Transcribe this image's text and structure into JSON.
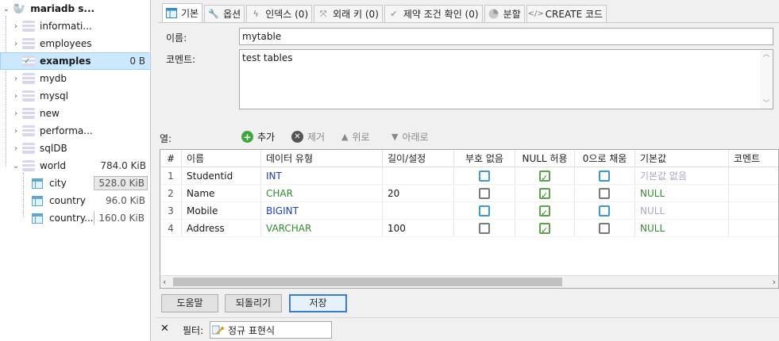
{
  "tree": {
    "root": "mariadb s...",
    "items": [
      {
        "label": "informati...",
        "size": ""
      },
      {
        "label": "employees",
        "size": ""
      },
      {
        "label": "examples",
        "size": "0 B"
      },
      {
        "label": "mydb",
        "size": ""
      },
      {
        "label": "mysql",
        "size": ""
      },
      {
        "label": "new",
        "size": ""
      },
      {
        "label": "performa...",
        "size": ""
      },
      {
        "label": "sqlDB",
        "size": ""
      },
      {
        "label": "world",
        "size": "784.0 KiB"
      }
    ],
    "tables": [
      {
        "label": "city",
        "size": "528.0 KiB"
      },
      {
        "label": "country",
        "size": "96.0 KiB"
      },
      {
        "label": "country...",
        "size": "160.0 KiB"
      }
    ]
  },
  "tabs": [
    {
      "label": "기본",
      "icon": "table-icon"
    },
    {
      "label": "옵션",
      "icon": "wrench-icon"
    },
    {
      "label": "인덱스 (0)",
      "icon": "lightning-icon"
    },
    {
      "label": "외래 키 (0)",
      "icon": "foreign-key-icon"
    },
    {
      "label": "제약 조건 확인 (0)",
      "icon": "check-icon"
    },
    {
      "label": "분할",
      "icon": "pie-icon"
    },
    {
      "label": "CREATE 코드",
      "icon": "code-icon"
    }
  ],
  "form": {
    "name_label": "이름:",
    "name_value": "mytable",
    "comment_label": "코멘트:",
    "comment_value": "test tables"
  },
  "columns_toolbar": {
    "label": "열:",
    "add": "추가",
    "remove": "제거",
    "up": "위로",
    "down": "아래로"
  },
  "grid": {
    "headers": [
      "#",
      "이름",
      "데이터 유형",
      "길이/설정",
      "부호 없음",
      "NULL 허용",
      "0으로 채움",
      "기본값",
      "코멘트"
    ],
    "rows": [
      {
        "num": "1",
        "name": "Studentid",
        "type": "INT",
        "type_color": "blue",
        "length": "",
        "unsigned": false,
        "nullable": true,
        "zerofill": false,
        "default": "기본값 없음",
        "default_color": "gray"
      },
      {
        "num": "2",
        "name": "Name",
        "type": "CHAR",
        "type_color": "green",
        "length": "20",
        "unsigned": false,
        "nullable": true,
        "zerofill": false,
        "default": "NULL",
        "default_color": "green"
      },
      {
        "num": "3",
        "name": "Mobile",
        "type": "BIGINT",
        "type_color": "blue",
        "length": "",
        "unsigned": false,
        "nullable": true,
        "zerofill": false,
        "default": "NULL",
        "default_color": "gray"
      },
      {
        "num": "4",
        "name": "Address",
        "type": "VARCHAR",
        "type_color": "green",
        "length": "100",
        "unsigned": false,
        "nullable": true,
        "zerofill": false,
        "default": "NULL",
        "default_color": "green"
      }
    ]
  },
  "buttons": {
    "help": "도움말",
    "discard": "되돌리기",
    "save": "저장"
  },
  "filter": {
    "close": "✕",
    "label": "필터:",
    "placeholder": "정규 표현식"
  }
}
